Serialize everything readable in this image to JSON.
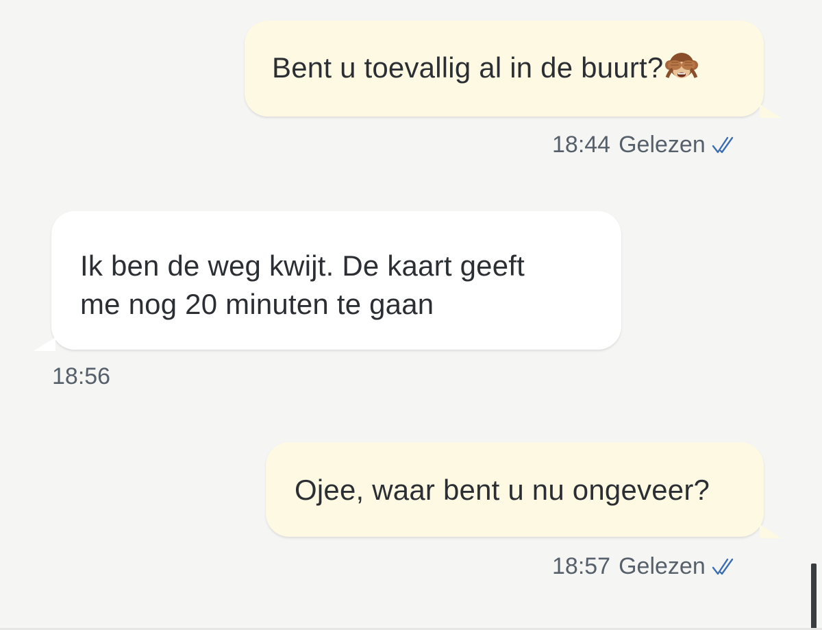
{
  "messages": [
    {
      "direction": "outgoing",
      "text": "Bent u toevallig al in de buurt?",
      "emoji": "see-no-evil-monkey",
      "time": "18:44",
      "status": "Gelezen"
    },
    {
      "direction": "incoming",
      "text": "Ik ben de weg kwijt. De kaart geeft\nme nog 20 minuten te gaan",
      "time": "18:56"
    },
    {
      "direction": "outgoing",
      "text": "Ojee, waar bent u nu ongeveer?",
      "time": "18:57",
      "status": "Gelezen"
    }
  ],
  "colors": {
    "background": "#f5f5f4",
    "outgoing_bubble": "#fdf9e3",
    "incoming_bubble": "#ffffff",
    "read_ticks": "#3b6db3",
    "meta_text": "#56606b"
  },
  "icons": {
    "read_receipt": "double-check-icon",
    "emoji": "see-no-evil-monkey-icon"
  }
}
